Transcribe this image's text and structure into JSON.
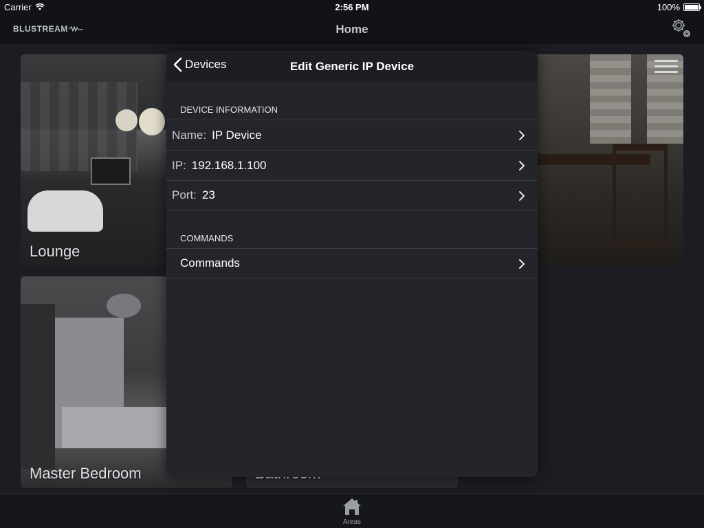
{
  "status_bar": {
    "carrier": "Carrier",
    "time": "2:56 PM",
    "battery": "100%",
    "battery_level": 1.0
  },
  "nav": {
    "logo": "BLUSTREAM",
    "title": "Home",
    "settings_icon": "gear-icon"
  },
  "tiles": {
    "lounge": "Lounge",
    "master_bedroom": "Master Bedroom",
    "bathroom": "Bathroom"
  },
  "modal": {
    "back_label": "Devices",
    "title": "Edit Generic IP Device",
    "sections": {
      "device_info_header": "DEVICE INFORMATION",
      "commands_header": "COMMANDS"
    },
    "fields": {
      "name_label": "Name:",
      "name_value": "IP Device",
      "ip_label": "IP:",
      "ip_value": "192.168.1.100",
      "port_label": "Port:",
      "port_value": "23"
    },
    "commands_row": "Commands"
  },
  "tab_bar": {
    "areas_label": "Areas",
    "areas_icon": "house-icon"
  },
  "colors": {
    "background": "#1b1d22",
    "modal_background": "#23252a",
    "modal_header": "#1c1e22",
    "separator": "#3a3c41"
  }
}
